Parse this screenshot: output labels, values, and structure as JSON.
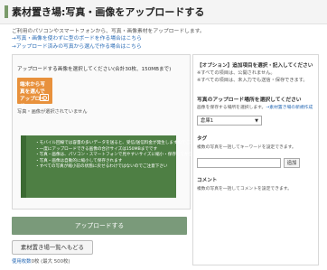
{
  "header": {
    "title": "素材置き場:写真・画像をアップロードする"
  },
  "intro": {
    "text": "ご利用のパソコンやスマートフォンから、写真・画像素材をアップロードします。",
    "link1": "→写真・画像を使わずに型のボードを作る場合はこちら",
    "link2": "→アップロード済みの写真から選んで作る場合はこちら"
  },
  "upload": {
    "heading": "アップロードする画像を選択してください(合計30枚、150MBまで)",
    "select_button": "端末から写真を選んでアップロード",
    "selected_status": "写真・画像が選択されていません",
    "notes": [
      "・モバイル回線では容量の多いデータを送ると、受信/送信料金が発生しますのでご利用下さい",
      "・一度にアップロードできる画像の合計サイズは150MBまでです",
      "・写真・画像は、パソコン・スマートフォンで見やすいサイズに縮小・保存してからアップロードします",
      "・写真・画像は自動的に縮小して保存されます",
      "・すべての写真が縮小前の状態に戻せるわけではないのでご注意下さい"
    ],
    "submit_label": "アップロードする"
  },
  "footer": {
    "back_label": "素材置き場一覧へもどる",
    "usage_link": "使用枚数",
    "usage_text": "0枚 (最大 500枚)"
  },
  "options": {
    "title": "【オプション】追加項目を選択・記入してください",
    "note1": "※すべての項目は、公開されません。",
    "note2": "※すべての項目は、未入力でも送信・保存できます。",
    "folder_heading": "写真のアップロード場所を選択してください",
    "folder_desc": "画像を保存する場所を選択します。",
    "folder_link": "→素材置き場の新規作成",
    "folder_value": "倉庫1",
    "tag_heading": "タグ",
    "tag_desc": "複数の写真を一括してキーワードを設定できます。",
    "tag_value": "",
    "tag_add": "追加",
    "comment_heading": "コメント",
    "comment_desc": "複数の写真を一括してコメントを設定できます。"
  }
}
